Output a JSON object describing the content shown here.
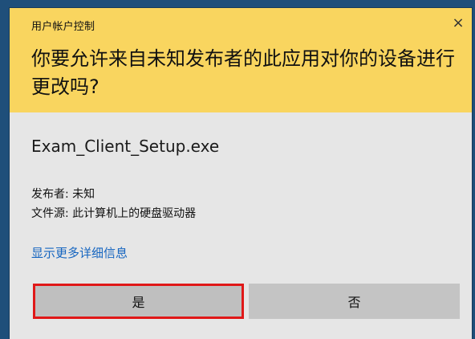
{
  "dialog": {
    "title": "用户帐户控制",
    "close_label": "×",
    "question": "你要允许来自未知发布者的此应用对你的设备进行更改吗?",
    "app_name": "Exam_Client_Setup.exe",
    "publisher_line": "发布者: 未知",
    "source_line": "文件源: 此计算机上的硬盘驱动器",
    "details_link": "显示更多详细信息",
    "buttons": {
      "yes": "是",
      "no": "否"
    }
  },
  "colors": {
    "header_bg": "#f9d55f",
    "dialog_bg": "#e6e6e6",
    "button_bg": "#c4c4c4",
    "focus_outline": "#e01818",
    "link": "#1565c0"
  },
  "icons": {
    "close": "close-icon"
  }
}
